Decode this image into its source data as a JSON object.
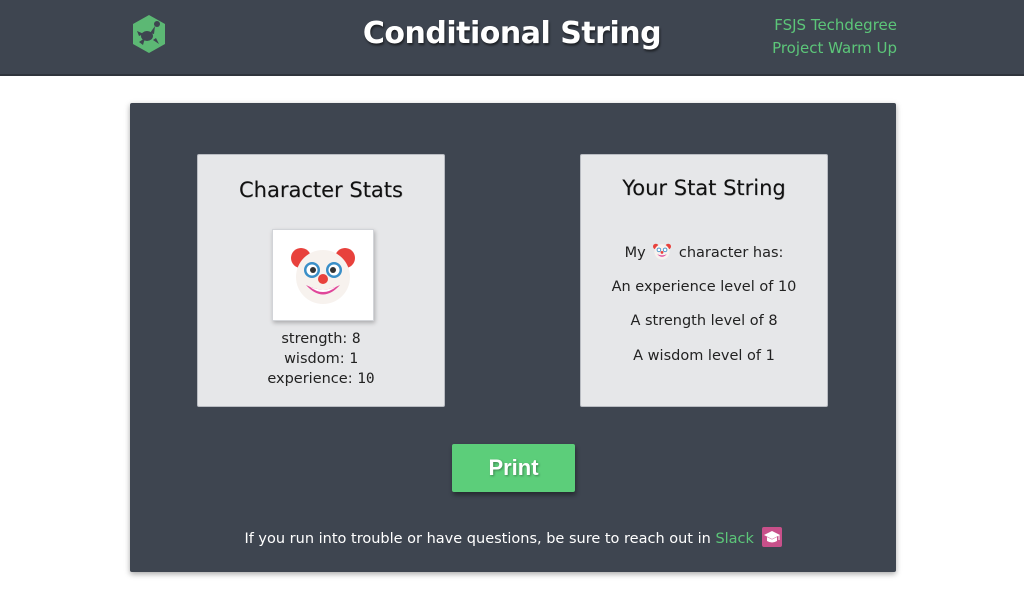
{
  "header": {
    "logo_icon": "treehouse-frog-logo",
    "title": "Conditional String",
    "links": [
      "FSJS Techdegree",
      "Project Warm Up"
    ],
    "accent_color": "#5cc679",
    "background_color": "#3e4550"
  },
  "stats_panel": {
    "title": "Character Stats",
    "avatar_icon": "clown-face-icon",
    "stats": [
      {
        "label": "strength:",
        "value": "8"
      },
      {
        "label": "wisdom:",
        "value": "1"
      },
      {
        "label": "experience:",
        "value": "10"
      }
    ]
  },
  "string_panel": {
    "title": "Your Stat String",
    "intro_prefix": "My",
    "intro_icon": "clown-face-icon",
    "intro_suffix": "character has:",
    "lines": [
      "An experience level of 10",
      "A strength level of 8",
      "A wisdom level of 1"
    ]
  },
  "print_button": {
    "label": "Print",
    "color": "#5cce7a"
  },
  "footer": {
    "text": "If you run into trouble or have questions, be sure to reach out in",
    "link_label": "Slack",
    "link_icon": "graduation-cap-icon"
  }
}
